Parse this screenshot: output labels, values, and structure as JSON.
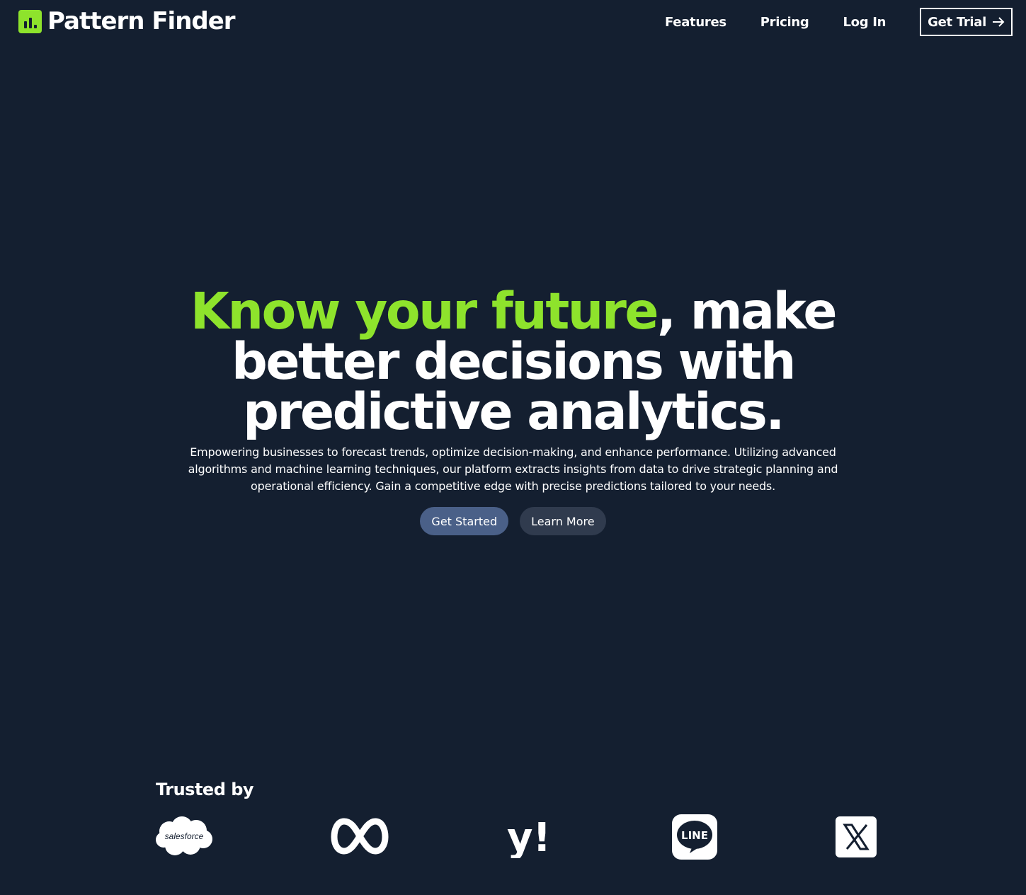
{
  "brand": {
    "name": "Pattern Finder",
    "icon": "bar-chart-icon",
    "accent_color": "#8ee32c"
  },
  "nav": {
    "items": [
      "Features",
      "Pricing",
      "Log In"
    ],
    "trial_label": "Get Trial",
    "trial_icon": "arrow-right-icon"
  },
  "hero": {
    "headline_accent": "Know your future",
    "headline_rest": ", make better decisions with predictive analytics.",
    "subtitle": "Empowering businesses to forecast trends, optimize decision-making, and enhance performance. Utilizing advanced algorithms and machine learning techniques, our platform extracts insights from data to drive strategic planning and operational efficiency. Gain a competitive edge with precise predictions tailored to your needs.",
    "primary_cta": "Get Started",
    "secondary_cta": "Learn More"
  },
  "trusted": {
    "title": "Trusted by",
    "logos": [
      {
        "name": "salesforce",
        "icon": "salesforce-logo",
        "text": "salesforce"
      },
      {
        "name": "meta",
        "icon": "meta-logo"
      },
      {
        "name": "yahoo",
        "icon": "yahoo-logo",
        "text": "y!"
      },
      {
        "name": "line",
        "icon": "line-logo",
        "text": "LINE"
      },
      {
        "name": "x",
        "icon": "x-logo"
      }
    ]
  },
  "colors": {
    "background": "#141f30",
    "primary_button": "#4a6088",
    "secondary_button": "#303b4e"
  }
}
